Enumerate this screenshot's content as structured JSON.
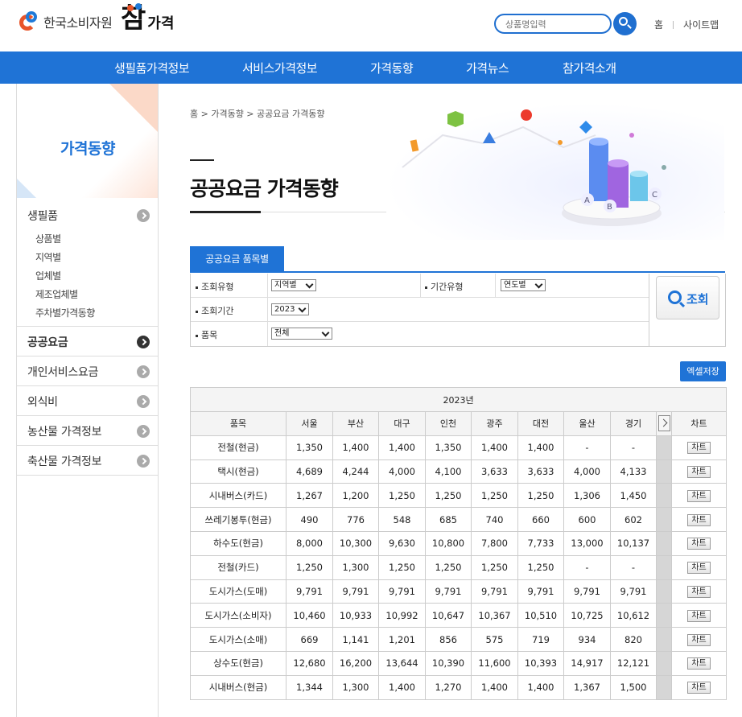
{
  "header": {
    "org_name": "한국소비자원",
    "brand_big": "참",
    "brand_small": "가격",
    "search_placeholder": "상품명입력",
    "links": [
      "홈",
      "사이트맵"
    ]
  },
  "gnb": [
    "생필품가격정보",
    "서비스가격정보",
    "가격동향",
    "가격뉴스",
    "참가격소개"
  ],
  "lnb": {
    "title": "가격동향",
    "first": "생필품",
    "sub": [
      "상품별",
      "지역별",
      "업체별",
      "제조업체별",
      "주차별가격동향"
    ],
    "items": [
      "공공요금",
      "개인서비스요금",
      "외식비",
      "농산물 가격정보",
      "축산물 가격정보"
    ]
  },
  "breadcrumb": "홈 > 가격동향 > 공공요금 가격동향",
  "page_title": "공공요금 가격동향",
  "hero_labels": [
    "A",
    "B",
    "C"
  ],
  "tab": "공공요금 품목별",
  "filter": {
    "query_type_label": "조회유형",
    "query_type_value": "지역별",
    "period_type_label": "기간유형",
    "period_type_value": "연도별",
    "period_label": "조회기간",
    "period_value": "2023",
    "item_label": "품목",
    "item_value": "전체",
    "lookup": "조회"
  },
  "excel": "엑셀저장",
  "table": {
    "year": "2023년",
    "columns": [
      "품목",
      "서울",
      "부산",
      "대구",
      "인천",
      "광주",
      "대전",
      "울산",
      "경기"
    ],
    "chart_col": "차트",
    "chart_btn": "차트",
    "rows": [
      [
        "전철(현금)",
        "1,350",
        "1,400",
        "1,400",
        "1,350",
        "1,400",
        "1,400",
        "-",
        "-"
      ],
      [
        "택시(현금)",
        "4,689",
        "4,244",
        "4,000",
        "4,100",
        "3,633",
        "3,633",
        "4,000",
        "4,133"
      ],
      [
        "시내버스(카드)",
        "1,267",
        "1,200",
        "1,250",
        "1,250",
        "1,250",
        "1,250",
        "1,306",
        "1,450"
      ],
      [
        "쓰레기봉투(현금)",
        "490",
        "776",
        "548",
        "685",
        "740",
        "660",
        "600",
        "602"
      ],
      [
        "하수도(현금)",
        "8,000",
        "10,300",
        "9,630",
        "10,800",
        "7,800",
        "7,733",
        "13,000",
        "10,137"
      ],
      [
        "전철(카드)",
        "1,250",
        "1,300",
        "1,250",
        "1,250",
        "1,250",
        "1,250",
        "-",
        "-"
      ],
      [
        "도시가스(도매)",
        "9,791",
        "9,791",
        "9,791",
        "9,791",
        "9,791",
        "9,791",
        "9,791",
        "9,791"
      ],
      [
        "도시가스(소비자)",
        "10,460",
        "10,933",
        "10,992",
        "10,647",
        "10,367",
        "10,510",
        "10,725",
        "10,612"
      ],
      [
        "도시가스(소매)",
        "669",
        "1,141",
        "1,201",
        "856",
        "575",
        "719",
        "934",
        "820"
      ],
      [
        "상수도(현금)",
        "12,680",
        "16,200",
        "13,644",
        "10,390",
        "11,600",
        "10,393",
        "14,917",
        "12,121"
      ],
      [
        "시내버스(현금)",
        "1,344",
        "1,300",
        "1,400",
        "1,270",
        "1,400",
        "1,400",
        "1,367",
        "1,500"
      ]
    ]
  }
}
